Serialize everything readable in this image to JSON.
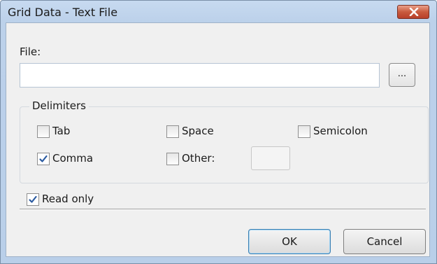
{
  "window": {
    "title": "Grid Data - Text File"
  },
  "file": {
    "label": "File:",
    "value": "",
    "browse_label": "..."
  },
  "delimiters": {
    "title": "Delimiters",
    "options": [
      {
        "label": "Tab",
        "checked": false
      },
      {
        "label": "Space",
        "checked": false
      },
      {
        "label": "Semicolon",
        "checked": false
      },
      {
        "label": "Comma",
        "checked": true
      },
      {
        "label": "Other:",
        "checked": false
      }
    ],
    "other_value": ""
  },
  "read_only": {
    "label": "Read only",
    "checked": true
  },
  "buttons": {
    "ok": "OK",
    "cancel": "Cancel"
  },
  "colors": {
    "titlebar": "#bcd1ea",
    "close": "#c95a3e",
    "client": "#f0f0f0"
  },
  "icons": {
    "close": "close-icon",
    "check": "checkmark-icon"
  }
}
